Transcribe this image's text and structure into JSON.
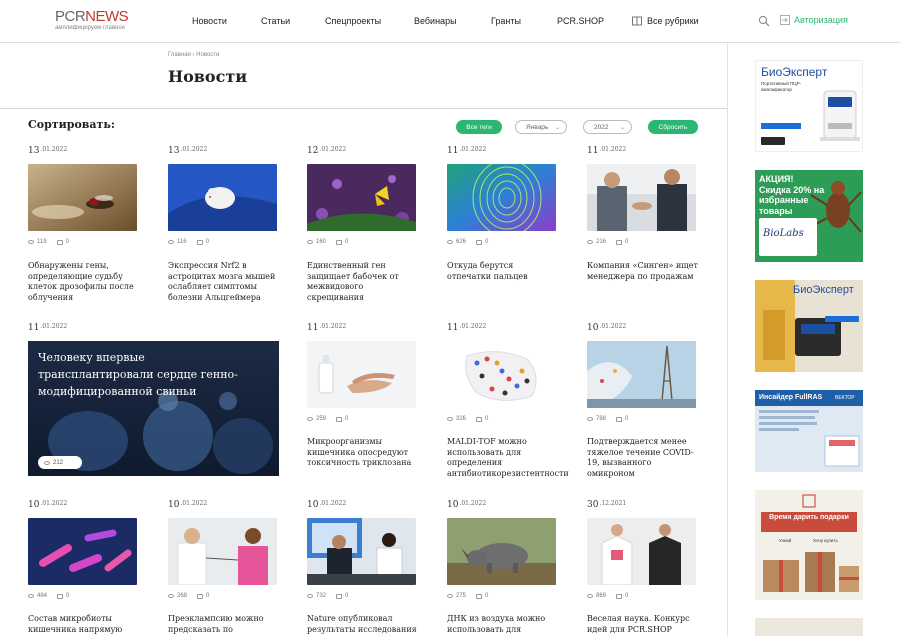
{
  "header": {
    "logo_pcr": "PCR",
    "logo_news": "NEWS",
    "logo_tagline": "амплифицируем главное",
    "nav": [
      "Новости",
      "Статьи",
      "Спецпроекты",
      "Вебинары",
      "Гранты",
      "PCR.SHOP",
      "Все рубрики"
    ],
    "login_label": "Авторизация"
  },
  "page": {
    "breadcrumb": "Главная › Новости",
    "title": "Новости"
  },
  "filters": {
    "sort_label": "Сортировать:",
    "all_tags": "Все теги",
    "month": "Январь",
    "year": "2022",
    "reset": "Сбросить"
  },
  "cards": [
    {
      "day": "13",
      "rest": ".01.2022",
      "views": "119",
      "comments": "0",
      "title": "Обнаружены гены, определяющие судьбу клеток дрозофилы после облучения"
    },
    {
      "day": "13",
      "rest": ".01.2022",
      "views": "116",
      "comments": "0",
      "title": "Экспрессия Nrf2 в астроцитах мозга мышей ослабляет симптомы болезни Альцгеймера"
    },
    {
      "day": "12",
      "rest": ".01.2022",
      "views": "160",
      "comments": "0",
      "title": "Единственный ген защищает бабочек от межвидового скрещивания"
    },
    {
      "day": "11",
      "rest": ".01.2022",
      "views": "626",
      "comments": "0",
      "title": "Откуда берутся отпечатки пальцев"
    },
    {
      "day": "11",
      "rest": ".01.2022",
      "views": "216",
      "comments": "0",
      "title": "Компания «Синген» ищет менеджера по продажам"
    },
    {
      "day": "11",
      "rest": ".01.2022",
      "views": "259",
      "comments": "0",
      "title": "Микроорганизмы кишечника опосредуют токсичность триклозана"
    },
    {
      "day": "11",
      "rest": ".01.2022",
      "views": "326",
      "comments": "0",
      "title": "MALDI-TOF можно использовать для определения антибиотикорезистентности"
    },
    {
      "day": "10",
      "rest": ".01.2022",
      "views": "788",
      "comments": "0",
      "title": "Подтверждается менее тяжелое течение COVID-19, вызванного омикроном"
    },
    {
      "day": "10",
      "rest": ".01.2022",
      "views": "484",
      "comments": "0",
      "title": "Состав микробиоты кишечника напрямую"
    },
    {
      "day": "10",
      "rest": ".01.2022",
      "views": "268",
      "comments": "0",
      "title": "Преэклампсию можно предсказать по"
    },
    {
      "day": "10",
      "rest": ".01.2022",
      "views": "732",
      "comments": "0",
      "title": "Nature опубликовал результаты исследования"
    },
    {
      "day": "10",
      "rest": ".01.2022",
      "views": "275",
      "comments": "0",
      "title": "ДНК из воздуха можно использовать для"
    },
    {
      "day": "30",
      "rest": ".12.2021",
      "views": "869",
      "comments": "0",
      "title": "Веселая наука. Конкурс идей для PCR.SHOP"
    }
  ],
  "featured": {
    "day": "11",
    "rest": ".01.2022",
    "title": "Человеку впервые трансплантировали сердце генно-модифицированной свиньи",
    "views": "212"
  },
  "ads": {
    "ad1_brand": "БиоЭксперт",
    "ad1_sub": "Портативный ПЦР-амплификатор",
    "ad2_title": "АКЦИЯ! Скидка 20% на избранные товары",
    "ad2_brand": "BioLabs",
    "ad3_brand": "БиоЭксперт",
    "ad4_title": "Инсайдер FullRAS",
    "ad4_brand": "ВЕКТОР",
    "ad5_title": "Время дарить подарки",
    "ad5_b1": "Узнай",
    "ad5_b2": "Хочу купить"
  }
}
